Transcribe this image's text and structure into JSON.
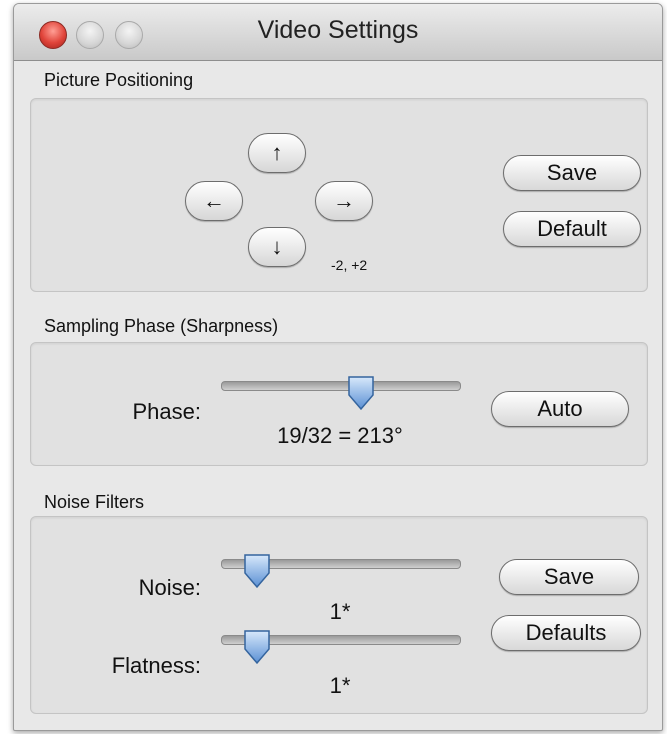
{
  "window": {
    "title": "Video Settings"
  },
  "picture_positioning": {
    "title": "Picture Positioning",
    "up_label": "↑",
    "left_label": "←",
    "right_label": "→",
    "down_label": "↓",
    "offset_readout": "-2, +2",
    "save_label": "Save",
    "default_label": "Default"
  },
  "sampling_phase": {
    "title": "Sampling Phase (Sharpness)",
    "phase_label": "Phase:",
    "phase_value": "19/32 = 213°",
    "phase_level": 0.59,
    "auto_label": "Auto"
  },
  "noise_filters": {
    "title": "Noise Filters",
    "noise_label": "Noise:",
    "noise_value": "1*",
    "noise_level": 0.15,
    "flatness_label": "Flatness:",
    "flatness_value": "1*",
    "flatness_level": 0.15,
    "save_label": "Save",
    "defaults_label": "Defaults"
  }
}
